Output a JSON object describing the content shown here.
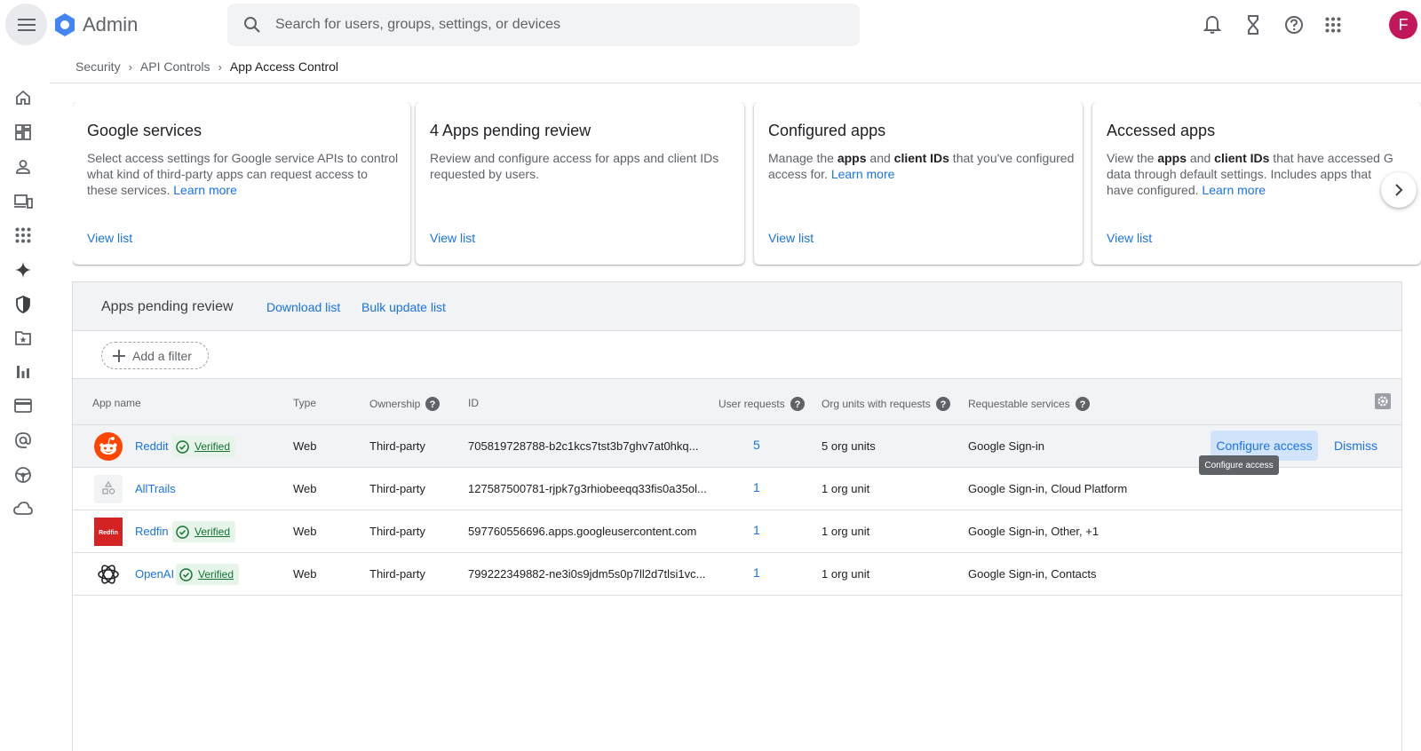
{
  "header": {
    "app_name": "Admin",
    "search_placeholder": "Search for users, groups, settings, or devices",
    "avatar_letter": "F",
    "icons": [
      "menu-icon",
      "bell-icon",
      "hourglass-icon",
      "help-icon",
      "apps-grid-icon"
    ]
  },
  "rail": {
    "icons": [
      "home-icon",
      "dashboard-icon",
      "person-icon",
      "devices-icon",
      "apps-icon",
      "gemini-icon",
      "security-shield-icon",
      "folder-star-icon",
      "reporting-chart-icon",
      "billing-card-icon",
      "account-at-icon",
      "rules-icon",
      "cloud-icon"
    ]
  },
  "breadcrumb": {
    "items": [
      "Security",
      "API Controls"
    ],
    "current": "App Access Control"
  },
  "cards": [
    {
      "title": "Google services",
      "desc_lines": [
        "Select access settings for Google service APIs to control",
        "what kind of third-party apps can request access to",
        "these services."
      ],
      "learn_more": "Learn more",
      "view_list": "View list"
    },
    {
      "title": "4 Apps pending review",
      "desc_lines": [
        "Review and configure access for apps and client IDs",
        "requested by users."
      ],
      "view_list": "View list"
    },
    {
      "title": "Configured apps",
      "desc_parts": [
        "Manage the ",
        "apps",
        " and ",
        "client IDs",
        " that you've configured"
      ],
      "desc_line2": "access for.",
      "learn_more": "Learn more",
      "view_list": "View list"
    },
    {
      "title": "Accessed apps",
      "desc_parts": [
        "View the ",
        "apps",
        " and ",
        "client IDs",
        " that have accessed G"
      ],
      "desc_line2": "data through default settings. Includes apps that",
      "desc_line3": "have configured.",
      "learn_more": "Learn more",
      "view_list": "View list"
    }
  ],
  "panel": {
    "title": "Apps pending review",
    "download_label": "Download list",
    "bulk_update_label": "Bulk update list",
    "add_filter_label": "Add a filter",
    "columns": {
      "app_name": "App name",
      "type": "Type",
      "ownership": "Ownership",
      "id": "ID",
      "user_requests": "User requests",
      "org_units": "Org units with requests",
      "services": "Requestable services"
    },
    "rows": [
      {
        "name": "Reddit",
        "verified": "Verified",
        "type": "Web",
        "ownership": "Third-party",
        "id": "705819728788-b2c1kcs7tst3b7ghv7at0hkq...",
        "user_requests": "5",
        "org_units": "5 org units",
        "services": "Google Sign-in"
      },
      {
        "name": "AllTrails",
        "verified": "",
        "type": "Web",
        "ownership": "Third-party",
        "id": "127587500781-rjpk7g3rhiobeeqq33fis0a35ol...",
        "user_requests": "1",
        "org_units": "1 org unit",
        "services": "Google Sign-in, Cloud Platform"
      },
      {
        "name": "Redfin",
        "verified": "Verified",
        "type": "Web",
        "ownership": "Third-party",
        "id": "597760556696.apps.googleusercontent.com",
        "user_requests": "1",
        "org_units": "1 org unit",
        "services": "Google Sign-in, Other, +1"
      },
      {
        "name": "OpenAI",
        "verified": "Verified",
        "type": "Web",
        "ownership": "Third-party",
        "id": "799222349882-ne3i0s9jdm5s0p7ll2d7tlsi1vc...",
        "user_requests": "1",
        "org_units": "1 org unit",
        "services": "Google Sign-in, Contacts"
      }
    ],
    "configure_label": "Configure access",
    "dismiss_label": "Dismiss",
    "tooltip": "Configure access",
    "redfin_logo_text": "Redfin"
  },
  "colors": {
    "accent": "#1a73e8",
    "avatar": "#c2185b",
    "verified_bg": "#e6f4ea",
    "verified_text": "#137333",
    "reddit": "#ff4500",
    "redfin": "#d32323"
  }
}
